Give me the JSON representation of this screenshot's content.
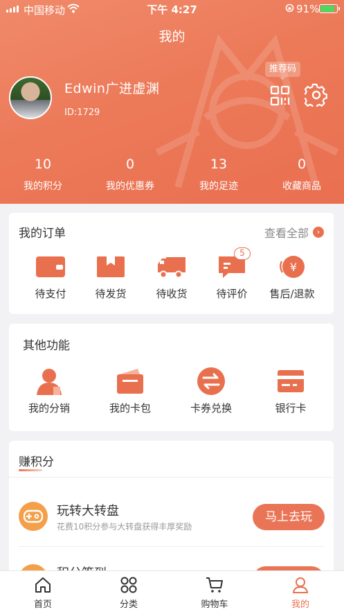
{
  "status_bar": {
    "carrier": "中国移动",
    "time": "下午 4:27",
    "battery": "91%"
  },
  "header": {
    "title": "我的",
    "username": "Edwin广进虚渊",
    "user_id": "ID:1729",
    "recommend_label": "推荐码",
    "stats": [
      {
        "value": "10",
        "label": "我的积分"
      },
      {
        "value": "0",
        "label": "我的优惠券"
      },
      {
        "value": "13",
        "label": "我的足迹"
      },
      {
        "value": "0",
        "label": "收藏商品"
      }
    ]
  },
  "orders": {
    "title": "我的订单",
    "view_all": "查看全部",
    "items": [
      {
        "label": "待支付",
        "icon": "wallet-icon"
      },
      {
        "label": "待发货",
        "icon": "box-icon"
      },
      {
        "label": "待收货",
        "icon": "truck-icon"
      },
      {
        "label": "待评价",
        "icon": "chat-icon",
        "badge": "5"
      },
      {
        "label": "售后/退款",
        "icon": "refund-icon"
      }
    ]
  },
  "functions": {
    "title": "其他功能",
    "items": [
      {
        "label": "我的分销",
        "icon": "user-icon"
      },
      {
        "label": "我的卡包",
        "icon": "card-wallet-icon"
      },
      {
        "label": "卡券兑换",
        "icon": "exchange-icon"
      },
      {
        "label": "银行卡",
        "icon": "bank-card-icon"
      }
    ]
  },
  "earn": {
    "title": "赚积分",
    "tasks": [
      {
        "name": "玩转大转盘",
        "desc": "花费10积分参与大转盘获得丰厚奖励",
        "button": "马上去玩"
      },
      {
        "name": "积分签到",
        "desc": "",
        "button": ""
      }
    ]
  },
  "tabbar": {
    "tabs": [
      {
        "label": "首页"
      },
      {
        "label": "分类"
      },
      {
        "label": "购物车"
      },
      {
        "label": "我的"
      }
    ]
  },
  "colors": {
    "accent": "#e9704f",
    "header_bg": "#ec7a59"
  }
}
